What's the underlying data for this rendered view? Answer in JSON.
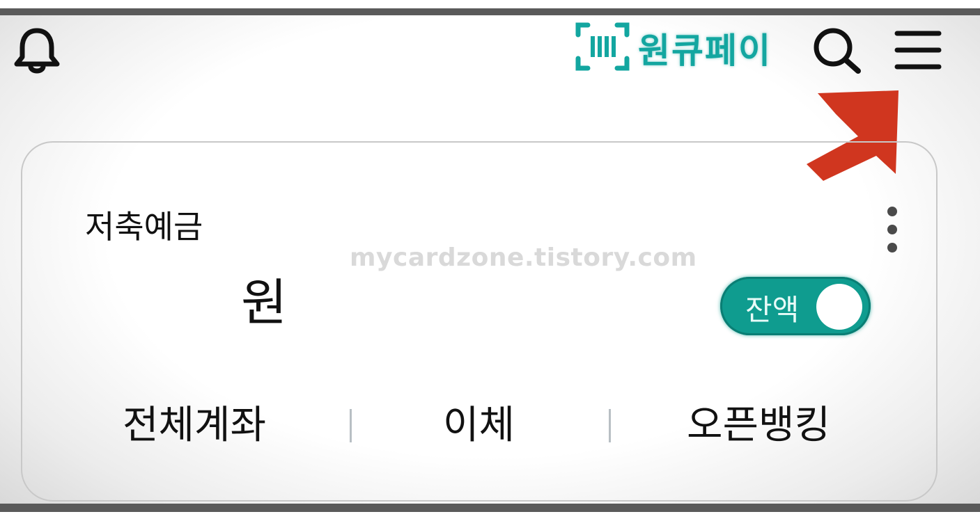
{
  "header": {
    "icons": {
      "notification": "bell-icon",
      "search": "search-icon",
      "menu": "hamburger-menu-icon",
      "pay": "barcode-scan-icon"
    },
    "pay_label": "원큐페이",
    "accent_color": "#13a6a0"
  },
  "overlay": {
    "watermark": "mycardzone.tistory.com",
    "arrow_color": "#d0361f"
  },
  "account_card": {
    "name": "저축예금",
    "amount_unit": "원",
    "balance_toggle": {
      "label": "잔액",
      "state": "on",
      "color": "#0f9c8f"
    },
    "actions": [
      {
        "label": "전체계좌"
      },
      {
        "label": "이체"
      },
      {
        "label": "오픈뱅킹"
      }
    ]
  }
}
